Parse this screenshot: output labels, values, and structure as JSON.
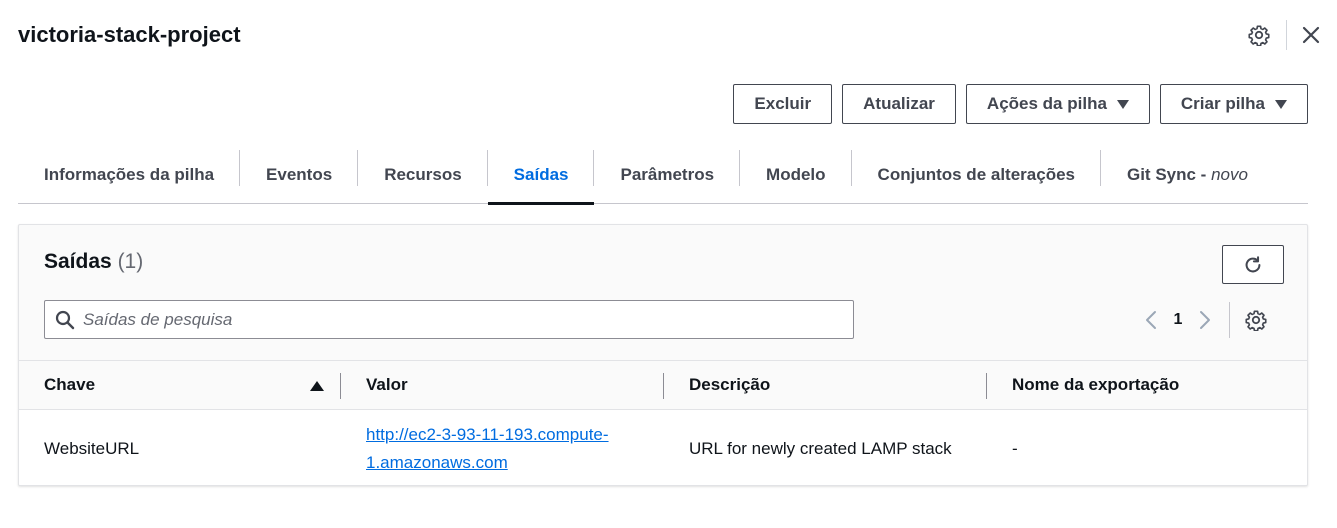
{
  "header": {
    "title": "victoria-stack-project"
  },
  "actions": {
    "delete": "Excluir",
    "update": "Atualizar",
    "stack_actions": "Ações da pilha",
    "create_stack": "Criar pilha"
  },
  "tabs": [
    {
      "label": "Informações da pilha"
    },
    {
      "label": "Eventos"
    },
    {
      "label": "Recursos"
    },
    {
      "label": "Saídas",
      "active": true
    },
    {
      "label": "Parâmetros"
    },
    {
      "label": "Modelo"
    },
    {
      "label": "Conjuntos de alterações"
    },
    {
      "label": "Git Sync - ",
      "suffix": "novo"
    }
  ],
  "outputs": {
    "title": "Saídas",
    "count": "(1)",
    "search_placeholder": "Saídas de pesquisa",
    "page": "1",
    "columns": [
      "Chave",
      "Valor",
      "Descrição",
      "Nome da exportação"
    ],
    "rows": [
      {
        "key": "WebsiteURL",
        "value_line1": "http://ec2-3-93-11-193.compute-",
        "value_line2": "1.amazonaws.com",
        "description": "URL for newly created LAMP stack",
        "export_name": "-"
      }
    ]
  },
  "colors": {
    "link": "#006ce0",
    "text": "#0f141a",
    "button_border": "#424650"
  }
}
